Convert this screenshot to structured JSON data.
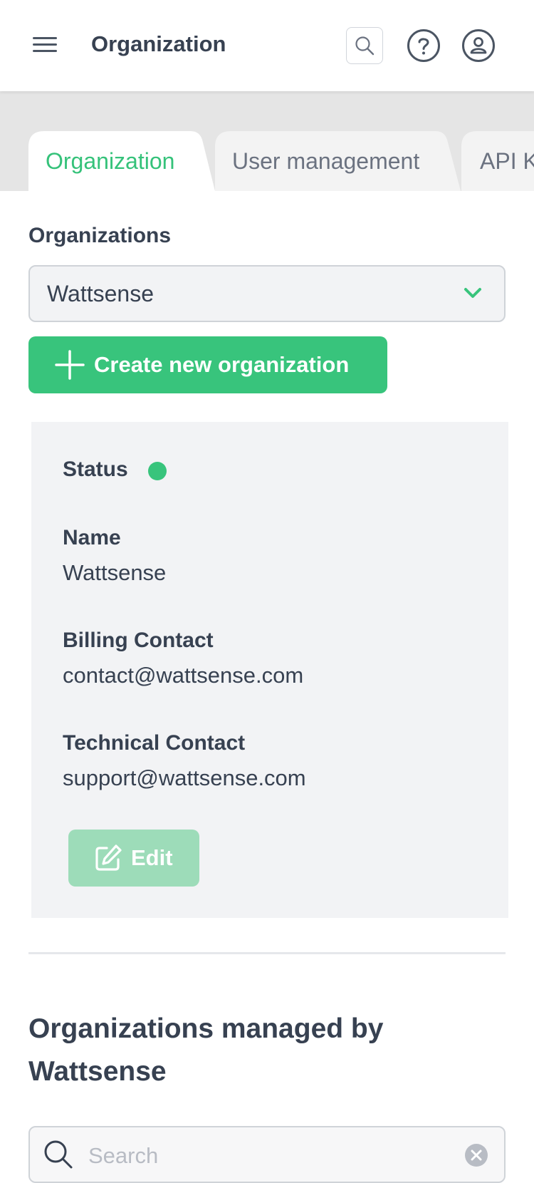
{
  "header": {
    "title": "Organization",
    "icons": [
      "menu-icon",
      "search-icon",
      "help-icon",
      "user-icon"
    ]
  },
  "tabs": [
    {
      "label": "Organization",
      "active": true
    },
    {
      "label": "User management",
      "active": false
    },
    {
      "label": "API K",
      "active": false
    }
  ],
  "organizations": {
    "label": "Organizations",
    "selected": "Wattsense",
    "create_label": "Create new organization"
  },
  "details": {
    "status_label": "Status",
    "status_color": "#38c47c",
    "name_label": "Name",
    "name_value": "Wattsense",
    "billing_label": "Billing Contact",
    "billing_value": "contact@wattsense.com",
    "technical_label": "Technical Contact",
    "technical_value": "support@wattsense.com",
    "edit_label": "Edit"
  },
  "managed": {
    "title": "Organizations managed by Wattsense",
    "search_placeholder": "Search"
  },
  "colors": {
    "accent": "#38c47c",
    "text": "#374151",
    "muted": "#6b7280"
  }
}
